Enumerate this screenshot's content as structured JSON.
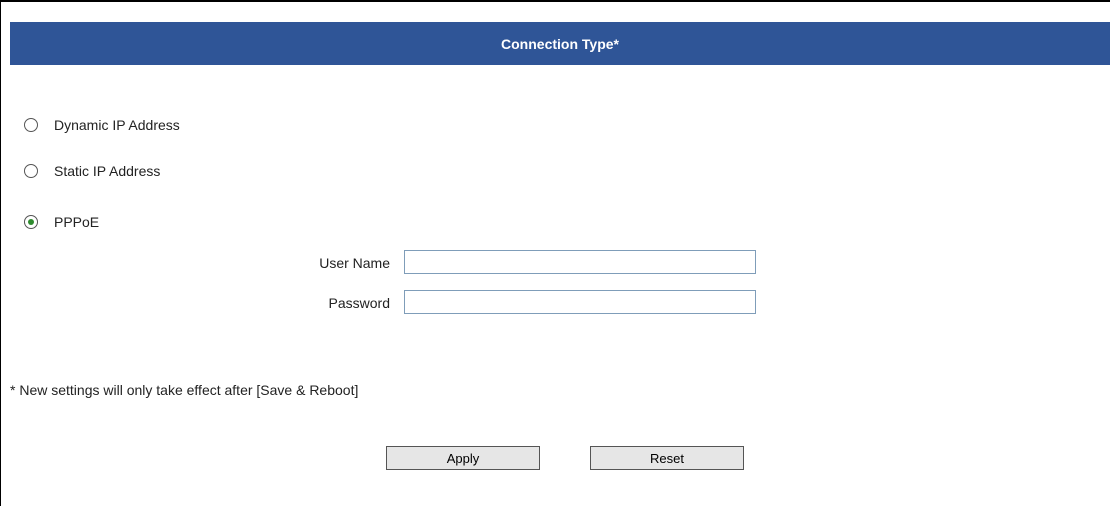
{
  "header": {
    "title": "Connection Type*"
  },
  "connection_options": [
    {
      "label": "Dynamic IP Address",
      "selected": false
    },
    {
      "label": "Static IP Address",
      "selected": false
    },
    {
      "label": "PPPoE",
      "selected": true
    }
  ],
  "pppoe": {
    "username_label": "User Name",
    "username_value": "",
    "password_label": "Password",
    "password_value": ""
  },
  "note": "* New settings will only take effect after [Save & Reboot]",
  "buttons": {
    "apply": "Apply",
    "reset": "Reset"
  },
  "colors": {
    "header_bg": "#2f5597",
    "header_text": "#ffffff",
    "radio_dot": "#2e8b2e",
    "input_border": "#7f9db9"
  }
}
